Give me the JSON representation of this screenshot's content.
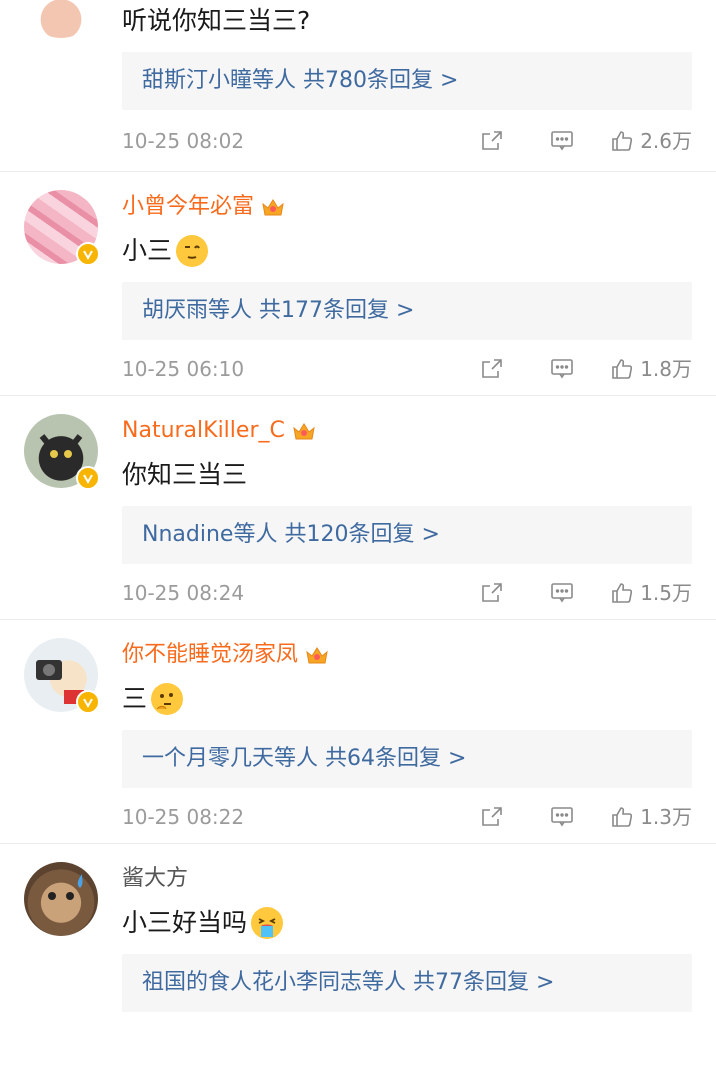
{
  "comments": [
    {
      "username": "",
      "text": "听说你知三当三?",
      "reply_who": "甜斯汀小瞳等人",
      "reply_count": "共780条回复 >",
      "time": "10-25 08:02",
      "likes": "2.6万"
    },
    {
      "username": "小曾今年必富",
      "text": "小三",
      "reply_who": "胡厌雨等人",
      "reply_count": "共177条回复 >",
      "time": "10-25 06:10",
      "likes": "1.8万"
    },
    {
      "username": "NaturalKiller_C",
      "text": "你知三当三",
      "reply_who": "Nnadine等人",
      "reply_count": "共120条回复 >",
      "time": "10-25 08:24",
      "likes": "1.5万"
    },
    {
      "username": "你不能睡觉汤家凤",
      "text": "三",
      "reply_who": "一个月零几天等人",
      "reply_count": "共64条回复 >",
      "time": "10-25 08:22",
      "likes": "1.3万"
    },
    {
      "username": "酱大方",
      "text": "小三好当吗",
      "reply_who": "祖国的食人花小李同志等人",
      "reply_count": "共77条回复 >",
      "time": "",
      "likes": ""
    }
  ],
  "colors": {
    "vip_name": "#f86b1d",
    "reply_link": "#3f6aa0",
    "reply_bg": "#f6f6f6",
    "meta": "#9b9b9b",
    "verified_badge": "#f7b500"
  },
  "icons": [
    "share-icon",
    "comment-icon",
    "like-icon",
    "crown-icon",
    "verified-icon"
  ]
}
